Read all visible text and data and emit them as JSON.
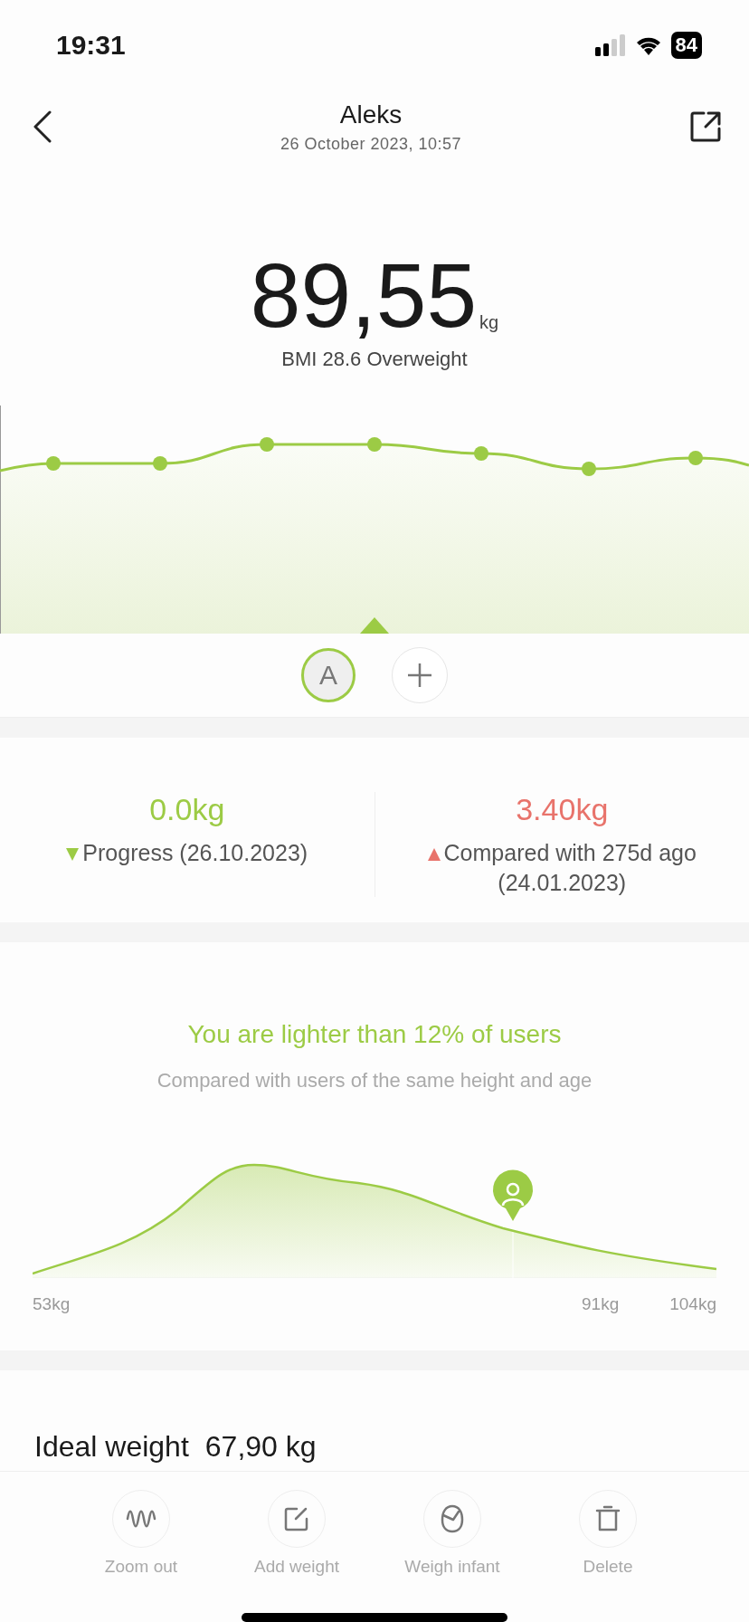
{
  "status_bar": {
    "time": "19:31",
    "battery": "84"
  },
  "header": {
    "title": "Aleks",
    "subtitle": "26 October 2023, 10:57"
  },
  "reading": {
    "value": "89,55",
    "unit": "kg",
    "bmi": "BMI 28.6 Overweight"
  },
  "profiles": [
    {
      "initial": "A",
      "selected": true
    }
  ],
  "stats": [
    {
      "value": "0.0kg",
      "label": "Progress (26.10.2023)",
      "kind": "down"
    },
    {
      "value": "3.40kg",
      "label": "Compared with 275d ago (24.01.2023)",
      "kind": "up"
    }
  ],
  "distribution": {
    "title": "You are lighter than 12% of users",
    "subtitle": "Compared with users of the same height and age",
    "axis_labels": [
      "53kg",
      "91kg",
      "104kg"
    ]
  },
  "ideal": {
    "label": "Ideal weight",
    "value": "67,90 kg"
  },
  "actions": [
    {
      "label": "Zoom out",
      "kind": "wave"
    },
    {
      "label": "Add weight",
      "kind": "edit"
    },
    {
      "label": "Weigh infant",
      "kind": "infant"
    },
    {
      "label": "Delete",
      "kind": "trash"
    }
  ]
}
